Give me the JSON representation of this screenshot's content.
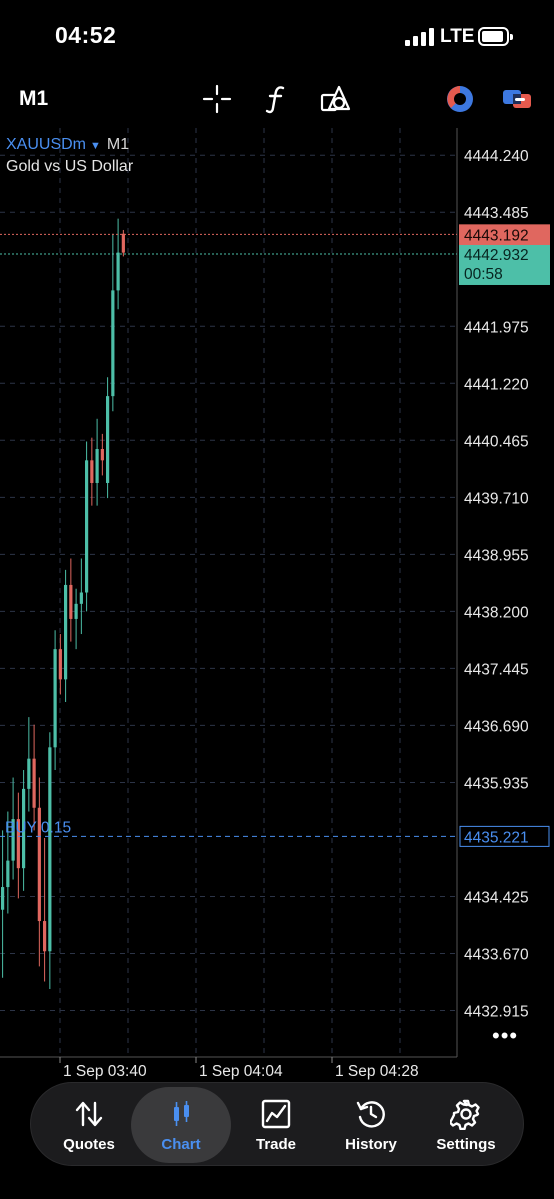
{
  "status_bar": {
    "time": "04:52",
    "network": "LTE"
  },
  "toolbar": {
    "timeframe": "M1",
    "tools": [
      "crosshair-icon",
      "function-icon",
      "objects-icon",
      "indicator-icon",
      "account-icon"
    ]
  },
  "chart_header": {
    "symbol": "XAUUSDm",
    "timeframe": "M1",
    "description": "Gold vs US Dollar"
  },
  "chart_data": {
    "type": "candlestick",
    "symbol": "XAUUSDm",
    "price_scale": [
      "4444.240",
      "4443.485",
      "4441.975",
      "4441.220",
      "4440.465",
      "4439.710",
      "4438.955",
      "4438.200",
      "4437.445",
      "4436.690",
      "4435.935",
      "4434.425",
      "4433.670",
      "4432.915"
    ],
    "ask_price": "4443.192",
    "bid_price": "4442.932",
    "countdown": "00:58",
    "position": {
      "label": "BUY 0.15",
      "price": "4435.221"
    },
    "time_labels": [
      "1 Sep 03:40",
      "1 Sep 04:04",
      "1 Sep 04:28"
    ],
    "ylim": [
      4432.3,
      4444.6
    ],
    "candles": [
      {
        "o": 4434.25,
        "h": 4435.3,
        "l": 4433.35,
        "c": 4434.55
      },
      {
        "o": 4434.55,
        "h": 4435.55,
        "l": 4434.2,
        "c": 4434.9
      },
      {
        "o": 4434.9,
        "h": 4436.0,
        "l": 4434.65,
        "c": 4435.45
      },
      {
        "o": 4435.45,
        "h": 4435.8,
        "l": 4434.4,
        "c": 4434.8
      },
      {
        "o": 4434.8,
        "h": 4436.1,
        "l": 4434.5,
        "c": 4435.85
      },
      {
        "o": 4435.85,
        "h": 4436.8,
        "l": 4435.55,
        "c": 4436.25
      },
      {
        "o": 4436.25,
        "h": 4436.7,
        "l": 4435.3,
        "c": 4435.6
      },
      {
        "o": 4435.6,
        "h": 4436.0,
        "l": 4433.5,
        "c": 4434.1
      },
      {
        "o": 4434.1,
        "h": 4435.2,
        "l": 4433.3,
        "c": 4433.7
      },
      {
        "o": 4433.7,
        "h": 4436.6,
        "l": 4433.2,
        "c": 4436.4
      },
      {
        "o": 4436.4,
        "h": 4437.95,
        "l": 4436.1,
        "c": 4437.7
      },
      {
        "o": 4437.7,
        "h": 4437.9,
        "l": 4437.1,
        "c": 4437.3
      },
      {
        "o": 4437.3,
        "h": 4438.75,
        "l": 4437.0,
        "c": 4438.55
      },
      {
        "o": 4438.55,
        "h": 4438.9,
        "l": 4437.8,
        "c": 4438.1
      },
      {
        "o": 4438.1,
        "h": 4438.5,
        "l": 4437.7,
        "c": 4438.3
      },
      {
        "o": 4438.3,
        "h": 4438.9,
        "l": 4437.9,
        "c": 4438.45
      },
      {
        "o": 4438.45,
        "h": 4440.45,
        "l": 4438.2,
        "c": 4440.2
      },
      {
        "o": 4440.2,
        "h": 4440.5,
        "l": 4439.6,
        "c": 4439.9
      },
      {
        "o": 4439.9,
        "h": 4440.75,
        "l": 4439.6,
        "c": 4440.35
      },
      {
        "o": 4440.35,
        "h": 4440.55,
        "l": 4440.0,
        "c": 4440.2
      },
      {
        "o": 4439.9,
        "h": 4441.3,
        "l": 4439.7,
        "c": 4441.05
      },
      {
        "o": 4441.05,
        "h": 4443.2,
        "l": 4440.85,
        "c": 4442.45
      },
      {
        "o": 4442.45,
        "h": 4443.4,
        "l": 4442.2,
        "c": 4442.95
      },
      {
        "o": 4443.2,
        "h": 4443.25,
        "l": 4442.9,
        "c": 4442.95
      }
    ]
  },
  "colors": {
    "bull": "#4dbfa8",
    "bear": "#e0675f",
    "ask_line": "#e0675f",
    "bid_line": "#4dbfa8",
    "position_line": "#4a8ff0",
    "grid": "#2c3447",
    "accent": "#4a8ff0"
  },
  "nav": [
    {
      "label": "Quotes",
      "icon": "quotes-icon"
    },
    {
      "label": "Chart",
      "icon": "chart-icon"
    },
    {
      "label": "Trade",
      "icon": "trade-icon"
    },
    {
      "label": "History",
      "icon": "history-icon"
    },
    {
      "label": "Settings",
      "icon": "settings-icon"
    }
  ],
  "nav_active": "Chart"
}
